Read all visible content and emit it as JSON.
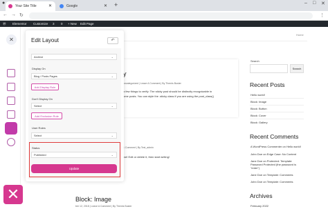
{
  "browser": {
    "tabs": [
      {
        "title": "Your Site Title",
        "favicon_color": "#d6388f"
      },
      {
        "title": "Google",
        "favicon_color": "#4285f4"
      }
    ],
    "url": ""
  },
  "adminbar": {
    "items": [
      "Elementor",
      "Customize",
      "3",
      "0",
      "+ New",
      "Edit Page"
    ]
  },
  "site": {
    "breadcrumb": "Home",
    "post_partial_title": "y",
    "post_meta": "uncategorized  |  Leave A Comment  |  By Themis Buster",
    "post_text_1": "a few things to verify: The sticky post should be distinctly recognizable in",
    "post_text_2": "ome posts. You can style the .sticky class if you are using the post_class()",
    "post2_meta": "1 Comment  |  By Test_admin",
    "post2_text": "ost! Edit or delete it, then start writing!",
    "block_image_title": "Block: Image",
    "block_meta": "ber 12, 2018  |  Leave A Comment  |  By Themis Buster"
  },
  "sidebar": {
    "search_label": "Search",
    "search_button": "Search",
    "recent_posts_title": "Recent Posts",
    "recent_posts": [
      "Hello world!",
      "Block: Image",
      "Block: Button",
      "Block: Cover",
      "Block: Gallery"
    ],
    "recent_comments_title": "Recent Comments",
    "recent_comments": [
      "A WordPress Commenter on Hello world!",
      "John Doe on Edge Case: No Content",
      "Jane Doe on Protected: Template:",
      "Password Protected (the password is",
      "\"enter\")",
      "Jane Doe on Template: Comments",
      "John Doe on Template: Comments"
    ],
    "archives_title": "Archives",
    "archives_first": "February 2022"
  },
  "panel": {
    "title": "Edit Layout",
    "layout_value": "Archive",
    "display_on_label": "Display On",
    "display_on_value": "Blog / Posts Pages",
    "add_display_rule": "Add Display Rule",
    "dont_display_label": "Don't Display On",
    "dont_display_value": "Select",
    "add_exclusion_rule": "Add Exclusion Rule",
    "user_roles_label": "User Roles",
    "user_roles_value": "Select",
    "status_label": "Status",
    "status_value": "Published",
    "update_button": "Update"
  },
  "colors": {
    "accent": "#d6388f",
    "highlight_border": "#e03a3a"
  }
}
